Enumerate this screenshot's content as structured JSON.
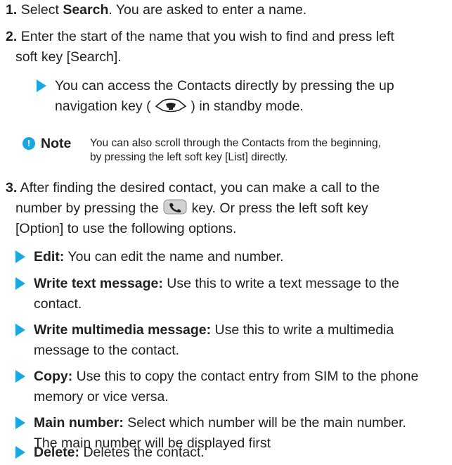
{
  "step1": {
    "num": "1.",
    "pre": "Select ",
    "bold": "Search",
    "post": ". You are asked to enter a name."
  },
  "step2": {
    "num": "2.",
    "line1": "Enter the start of the name that you wish to find and press left",
    "line2": "soft key [Search]."
  },
  "tip": {
    "line1": "You can access the Contacts directly by pressing the up",
    "pre_icon": "navigation key ( ",
    "post_icon": " ) in standby mode.",
    "icon": "up-navigation-key-icon"
  },
  "note": {
    "label": "Note",
    "line1": "You can also scroll through the Contacts from the beginning,",
    "line2": "by pressing the left soft key [List] directly."
  },
  "step3": {
    "num": "3.",
    "line1": "After finding the desired contact, you can make a call to the",
    "pre_icon": "number by pressing the ",
    "post_icon": " key. Or press the left soft key",
    "line3": "[Option] to use the following options.",
    "icon": "send-key-icon"
  },
  "options": [
    {
      "term": "Edit:",
      "line1": " You can edit the name and number.",
      "line2": ""
    },
    {
      "term": "Write text message:",
      "line1": " Use this to write a text message to the",
      "line2": "contact."
    },
    {
      "term": "Write multimedia message:",
      "line1": " Use this to write a multimedia",
      "line2": "message to the contact."
    },
    {
      "term": "Copy:",
      "line1": " Use this to copy the contact entry from SIM to the phone",
      "line2": "memory or vice versa."
    },
    {
      "term": "Main number:",
      "line1": " Select which number will be the main number.",
      "line2": "The main number will be displayed first"
    },
    {
      "term": "Delete:",
      "line1": " Deletes the contact.",
      "line2": ""
    }
  ],
  "colors": {
    "accent": "#1aa6e0",
    "text": "#231f20"
  }
}
